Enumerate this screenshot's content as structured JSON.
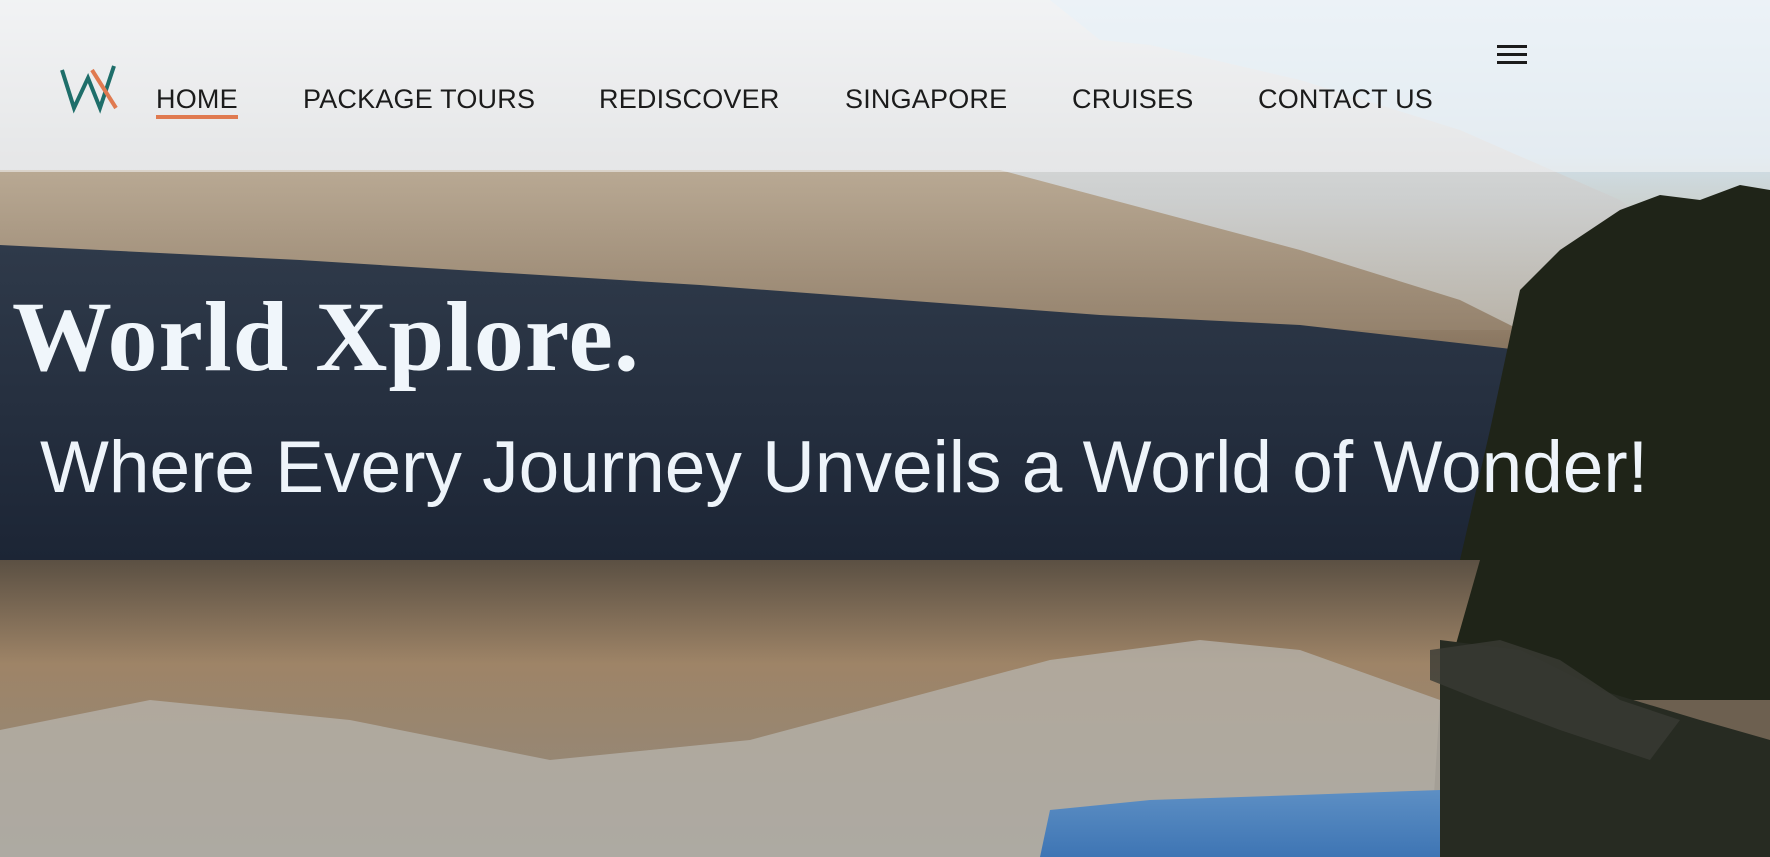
{
  "nav": {
    "logo_icon": "wx-logo-icon",
    "brand_colors": {
      "teal": "#1e6e6a",
      "orange": "#e07a50"
    },
    "items": [
      {
        "label": "HOME",
        "active": true
      },
      {
        "label": "PACKAGE TOURS",
        "active": false
      },
      {
        "label": "REDISCOVER",
        "active": false
      },
      {
        "label": "SINGAPORE",
        "active": false
      },
      {
        "label": "CRUISES",
        "active": false
      },
      {
        "label": "CONTACT US",
        "active": false
      }
    ],
    "menu_icon": "hamburger-menu-icon"
  },
  "hero": {
    "title": "World Xplore.",
    "subtitle": "Where Every Journey Unveils a World of Wonder!",
    "background": "mountain-lake-reflection-photo"
  }
}
